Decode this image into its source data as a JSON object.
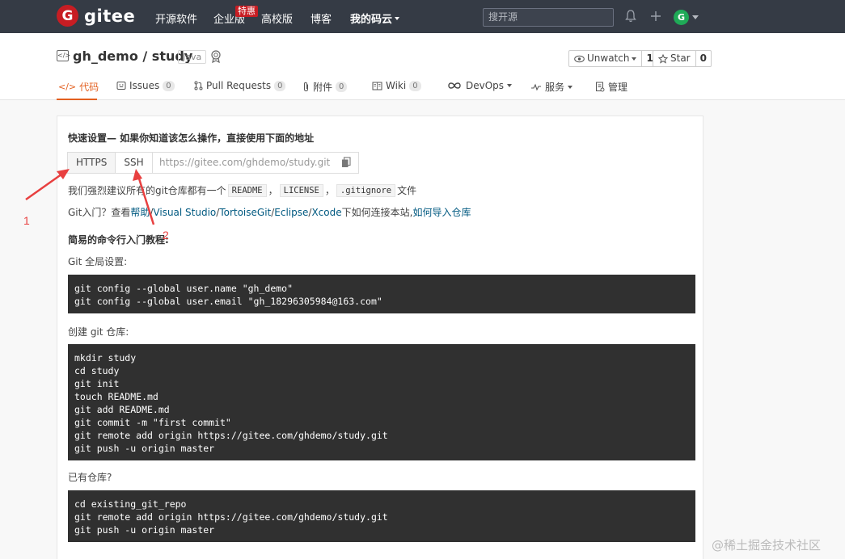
{
  "topbar": {
    "logo_mark": "G",
    "logo_text": "gitee",
    "nav": [
      "开源软件",
      "企业版",
      "高校版",
      "博客",
      "我的码云"
    ],
    "hot_badge": "特惠",
    "search_placeholder": "搜开源",
    "avatar_letter": "G",
    "bg_color": "#353b45"
  },
  "repo": {
    "title": "gh_demo / study",
    "language": "Java",
    "watch_label": "Unwatch",
    "watch_count": "1",
    "star_label": "Star",
    "star_count": "0",
    "tabs": [
      {
        "label": "代码",
        "count": ""
      },
      {
        "label": "Issues",
        "count": "0"
      },
      {
        "label": "Pull Requests",
        "count": "0"
      },
      {
        "label": "附件",
        "count": "0"
      },
      {
        "label": "Wiki",
        "count": "0"
      },
      {
        "label": "DevOps",
        "count": ""
      },
      {
        "label": "服务",
        "count": ""
      },
      {
        "label": "管理",
        "count": ""
      }
    ],
    "accent_color": "#e35f1f"
  },
  "setup": {
    "title": "快速设置— 如果你知道该怎么操作，直接使用下面的地址",
    "https_label": "HTTPS",
    "ssh_label": "SSH",
    "url": "https://gitee.com/ghdemo/study.git",
    "suggest_prefix": "我们强烈建议所有的git仓库都有一个",
    "suggest_files": [
      "README",
      "LICENSE",
      ".gitignore"
    ],
    "suggest_sep": "，",
    "suggest_suffix": "文件",
    "help_prefix": "Git入门？查看 ",
    "help_link": "帮助",
    "help_tools": [
      "Visual Studio",
      "TortoiseGit",
      "Eclipse",
      "Xcode"
    ],
    "help_sep": " / ",
    "help_middle": " 下如何连接本站, ",
    "help_import": "如何导入仓库"
  },
  "tutorial": {
    "title": "简易的命令行入门教程:",
    "global_label": "Git 全局设置:",
    "global_code": "git config --global user.name \"gh_demo\"\ngit config --global user.email \"gh_18296305984@163.com\"",
    "create_label": "创建 git 仓库:",
    "create_code": "mkdir study\ncd study\ngit init\ntouch README.md\ngit add README.md\ngit commit -m \"first commit\"\ngit remote add origin https://gitee.com/ghdemo/study.git\ngit push -u origin master",
    "existing_label": "已有仓库?",
    "existing_code": "cd existing_git_repo\ngit remote add origin https://gitee.com/ghdemo/study.git\ngit push -u origin master"
  },
  "annotations": {
    "num1": "1",
    "num2": "2",
    "color": "#e84040"
  },
  "watermark": "@稀土掘金技术社区"
}
